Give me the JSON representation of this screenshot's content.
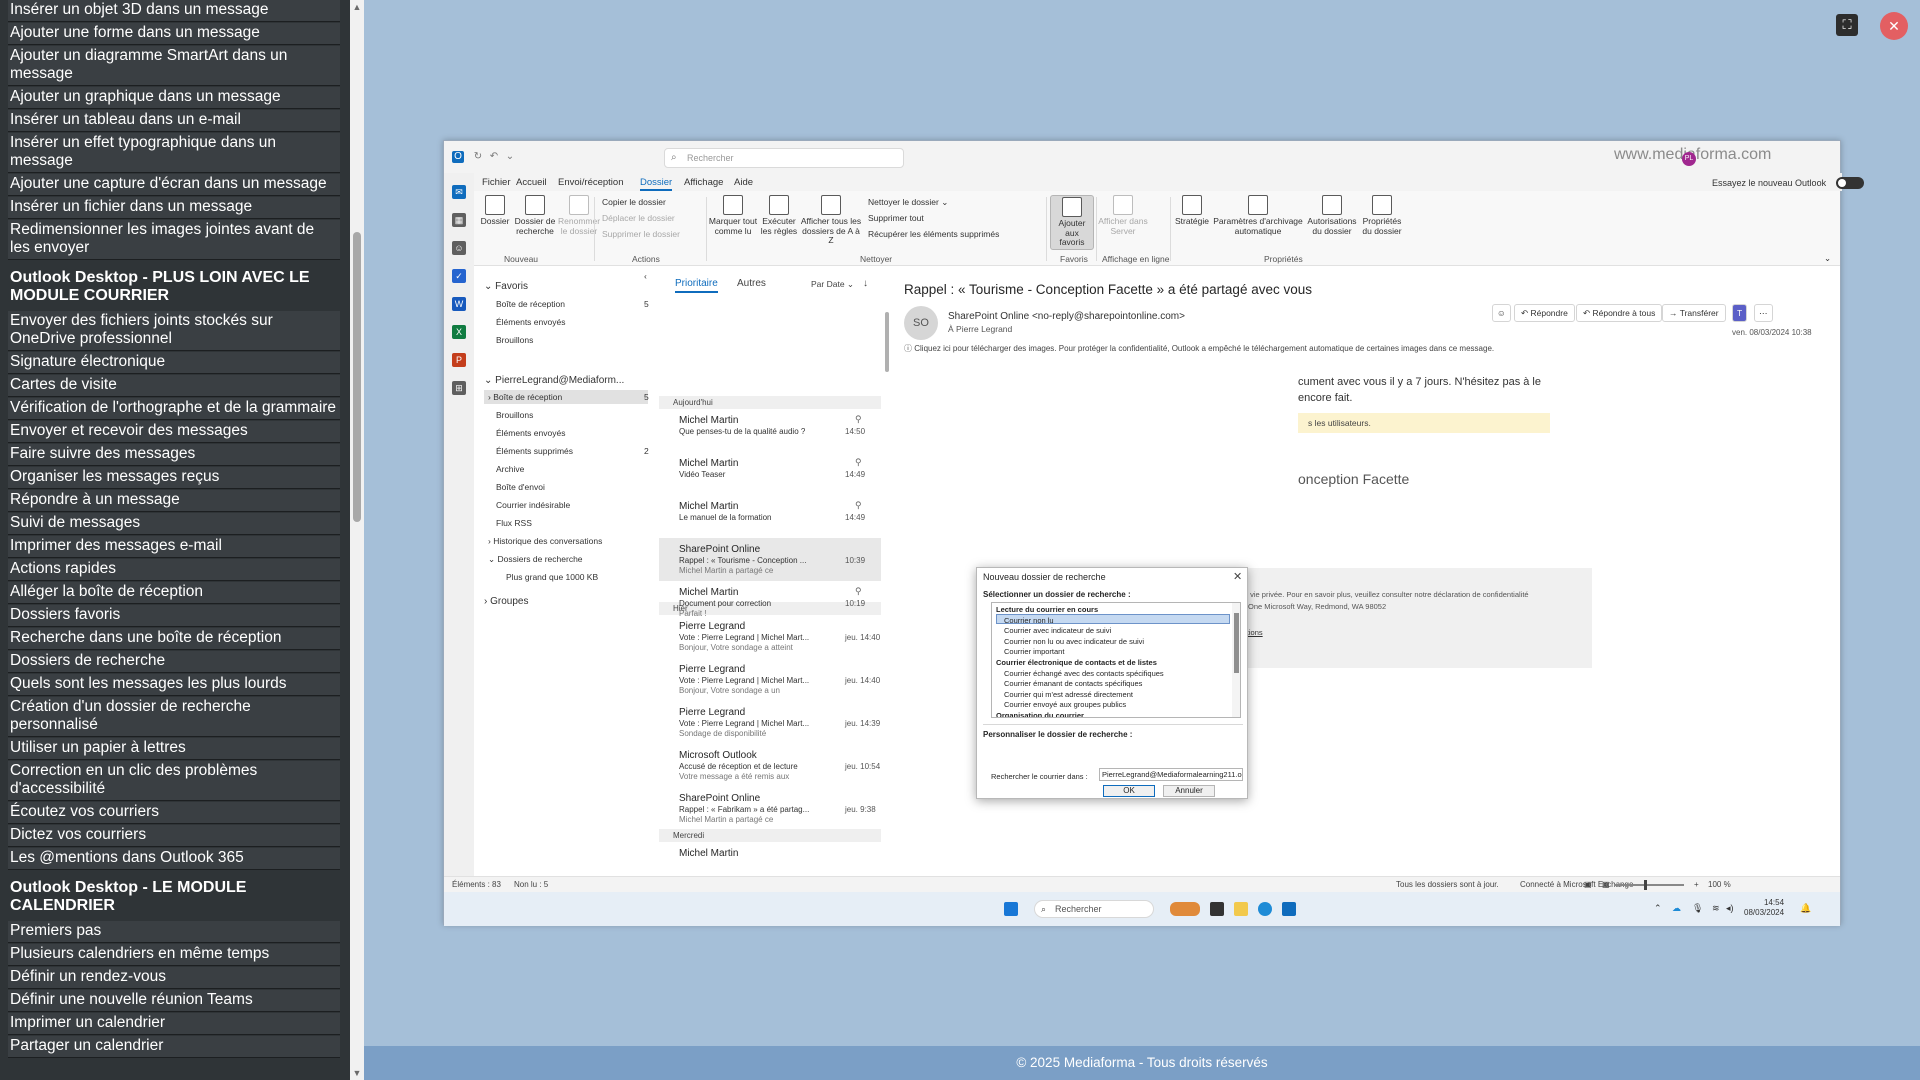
{
  "sidebar": {
    "items": [
      {
        "kind": "item",
        "label": "Insérer un objet 3D dans un message"
      },
      {
        "kind": "item",
        "label": "Ajouter une forme dans un message"
      },
      {
        "kind": "item",
        "label": "Ajouter un diagramme SmartArt dans un message"
      },
      {
        "kind": "item",
        "label": "Ajouter un graphique dans un message"
      },
      {
        "kind": "item",
        "label": "Insérer un tableau dans un e-mail"
      },
      {
        "kind": "item",
        "label": "Insérer un effet typographique dans un message"
      },
      {
        "kind": "item",
        "label": "Ajouter une capture d'écran dans un message"
      },
      {
        "kind": "item",
        "label": "Insérer un fichier dans un message"
      },
      {
        "kind": "item",
        "label": "Redimensionner les images jointes avant de les envoyer"
      },
      {
        "kind": "heading",
        "label": "Outlook Desktop - PLUS LOIN AVEC LE MODULE COURRIER"
      },
      {
        "kind": "item",
        "label": "Envoyer des fichiers joints stockés sur OneDrive professionnel"
      },
      {
        "kind": "item",
        "label": "Signature électronique"
      },
      {
        "kind": "item",
        "label": "Cartes de visite"
      },
      {
        "kind": "item",
        "label": "Vérification de l'orthographe et de la grammaire"
      },
      {
        "kind": "item",
        "label": "Envoyer et recevoir des messages"
      },
      {
        "kind": "item",
        "label": "Faire suivre des messages"
      },
      {
        "kind": "item",
        "label": "Organiser les messages reçus"
      },
      {
        "kind": "item",
        "label": "Répondre à un message"
      },
      {
        "kind": "item",
        "label": "Suivi de messages"
      },
      {
        "kind": "item",
        "label": "Imprimer des messages e-mail"
      },
      {
        "kind": "item",
        "label": "Actions rapides"
      },
      {
        "kind": "item",
        "label": "Alléger la boîte de réception"
      },
      {
        "kind": "item",
        "label": "Dossiers favoris"
      },
      {
        "kind": "item",
        "label": "Recherche dans une boîte de réception"
      },
      {
        "kind": "item",
        "label": "Dossiers de recherche"
      },
      {
        "kind": "item",
        "label": "Quels sont les messages les plus lourds"
      },
      {
        "kind": "item",
        "label": "Création d'un dossier de recherche personnalisé"
      },
      {
        "kind": "item",
        "label": "Utiliser un papier à lettres"
      },
      {
        "kind": "item",
        "label": "Correction en un clic des problèmes d'accessibilité"
      },
      {
        "kind": "item",
        "label": "Écoutez vos courriers"
      },
      {
        "kind": "item",
        "label": "Dictez vos courriers"
      },
      {
        "kind": "item",
        "label": "Les @mentions dans Outlook 365"
      },
      {
        "kind": "heading",
        "label": "Outlook Desktop - LE MODULE CALENDRIER"
      },
      {
        "kind": "item",
        "label": "Premiers pas"
      },
      {
        "kind": "item",
        "label": "Plusieurs calendriers en même temps"
      },
      {
        "kind": "item",
        "label": "Définir un rendez-vous"
      },
      {
        "kind": "item",
        "label": "Définir une nouvelle réunion Teams"
      },
      {
        "kind": "item",
        "label": "Imprimer un calendrier"
      },
      {
        "kind": "item",
        "label": "Partager un calendrier"
      }
    ]
  },
  "footer": "© 2025 Mediaforma - Tous droits réservés",
  "outlook": {
    "search_placeholder": "Rechercher",
    "watermark": "www.mediaforma.com",
    "avatar_initials": "PL",
    "menu": [
      "Fichier",
      "Accueil",
      "Envoi/réception",
      "Dossier",
      "Affichage",
      "Aide"
    ],
    "try_new_outlook": "Essayez le nouveau Outlook",
    "ribbon": {
      "dossier": "Dossier",
      "dossier_recherche": "Dossier de recherche",
      "renommer": "Renommer le dossier",
      "copier": "Copier le dossier",
      "deplacer": "Déplacer le dossier",
      "supprimer_dossier": "Supprimer le dossier",
      "marquer_lu": "Marquer tout comme lu",
      "executer_regles": "Exécuter les règles",
      "afficher_az": "Afficher tous les dossiers de A à Z",
      "nettoyer": "Nettoyer le dossier ⌄",
      "supprimer_tout": "Supprimer tout",
      "recuperer": "Récupérer les éléments supprimés",
      "favoris_btn": "Ajouter aux favoris",
      "afficher_serveur": "Afficher dans Server",
      "strategie": "Stratégie",
      "archivage": "Paramètres d'archivage automatique",
      "autorisations": "Autorisations du dossier",
      "proprietes": "Propriétés du dossier",
      "groups": [
        "Nouveau",
        "Actions",
        "Nettoyer",
        "Favoris",
        "Affichage en ligne",
        "Propriétés"
      ]
    },
    "folders": {
      "favoris": "Favoris",
      "fav_items": [
        {
          "label": "Boîte de réception",
          "count": "5"
        },
        {
          "label": "Éléments envoyés",
          "count": ""
        },
        {
          "label": "Brouillons",
          "count": ""
        }
      ],
      "account": "PierreLegrand@Mediaform...",
      "items": [
        {
          "label": "Boîte de réception",
          "count": "5"
        },
        {
          "label": "Brouillons",
          "count": ""
        },
        {
          "label": "Éléments envoyés",
          "count": ""
        },
        {
          "label": "Éléments supprimés",
          "count": "2"
        },
        {
          "label": "Archive",
          "count": ""
        },
        {
          "label": "Boîte d'envoi",
          "count": ""
        },
        {
          "label": "Courrier indésirable",
          "count": ""
        },
        {
          "label": "Flux RSS",
          "count": ""
        },
        {
          "label": "Historique des conversations",
          "count": ""
        },
        {
          "label": "Dossiers de recherche",
          "count": ""
        },
        {
          "label": "Plus grand que 1000 KB",
          "count": ""
        }
      ],
      "groupes": "Groupes"
    },
    "list": {
      "tab_prio": "Prioritaire",
      "tab_other": "Autres",
      "sort": "Par Date",
      "groups": [
        "Aujourd'hui",
        "Hier",
        "Mercredi"
      ],
      "messages": [
        {
          "from": "Michel Martin",
          "subject": "Que penses-tu de la qualité audio ?",
          "preview": "",
          "time": "14:50"
        },
        {
          "from": "Michel Martin",
          "subject": "Vidéo Teaser",
          "preview": "",
          "time": "14:49"
        },
        {
          "from": "Michel Martin",
          "subject": "Le manuel de la formation",
          "preview": "",
          "time": "14:49"
        },
        {
          "from": "SharePoint Online",
          "subject": "Rappel : « Tourisme - Conception ...",
          "preview": "Michel Martin a partagé ce",
          "time": "10:39"
        },
        {
          "from": "Michel Martin",
          "subject": "Document pour correction",
          "preview": "Parfait !",
          "time": "10:19"
        },
        {
          "from": "Pierre Legrand",
          "subject": "Vote : Pierre Legrand | Michel Mart...",
          "preview": "Bonjour, Votre sondage a atteint",
          "time": "jeu. 14:40"
        },
        {
          "from": "Pierre Legrand",
          "subject": "Vote : Pierre Legrand | Michel Mart...",
          "preview": "Bonjour, Votre sondage a un",
          "time": "jeu. 14:40"
        },
        {
          "from": "Pierre Legrand",
          "subject": "Vote : Pierre Legrand | Michel Mart...",
          "preview": "Sondage de disponibilité",
          "time": "jeu. 14:39"
        },
        {
          "from": "Microsoft Outlook",
          "subject": "Accusé de réception et de lecture",
          "preview": "Votre message a été remis aux",
          "time": "jeu. 10:54"
        },
        {
          "from": "SharePoint Online",
          "subject": "Rappel : « Fabrikam » a été partag...",
          "preview": "Michel Martin a partagé ce",
          "time": "jeu. 9:38"
        },
        {
          "from": "Michel Martin",
          "subject": "",
          "preview": "",
          "time": ""
        }
      ]
    },
    "reading": {
      "subject": "Rappel : « Tourisme - Conception Facette » a été partagé avec vous",
      "avatar": "SO",
      "from": "SharePoint Online <no-reply@sharepointonline.com>",
      "to": "À   Pierre Legrand",
      "buttons": [
        "Répondre",
        "Répondre à tous",
        "Transférer"
      ],
      "date": "ven. 08/03/2024 10:38",
      "info": "Cliquez ici pour télécharger des images. Pour protéger la confidentialité, Outlook a empêché le téléchargement automatique de certaines images dans ce message.",
      "body1": "cument avec vous il y a 7 jours. N'hésitez pas à le",
      "body2": "encore fait.",
      "yellow": "s les utilisateurs.",
      "title2": "onception Facette",
      "legal1": "Microsoft respecte votre vie privée. Pour en savoir plus, veuillez consulter notre déclaration de confidentialité",
      "legal2": ". Microsoft Corporation, One Microsoft Way, Redmond, WA 98052",
      "notif": "Paramètres des notifications"
    },
    "status": {
      "elements": "Éléments : 83",
      "non_lu": "Non lu : 5",
      "sync": "Tous les dossiers sont à jour.",
      "connected": "Connecté à Microsoft Exchange",
      "zoom": "100 %"
    },
    "taskbar": {
      "search": "Rechercher",
      "time": "14:54",
      "date": "08/03/2024"
    }
  },
  "dialog": {
    "title": "Nouveau dossier de recherche",
    "select_label": "Sélectionner un dossier de recherche :",
    "list": [
      {
        "kind": "cat",
        "label": "Lecture du courrier en cours"
      },
      {
        "kind": "it",
        "label": "Courrier non lu"
      },
      {
        "kind": "it",
        "label": "Courrier avec indicateur de suivi"
      },
      {
        "kind": "it",
        "label": "Courrier non lu ou avec indicateur de suivi"
      },
      {
        "kind": "it",
        "label": "Courrier important"
      },
      {
        "kind": "cat",
        "label": "Courrier électronique de contacts et de listes"
      },
      {
        "kind": "it",
        "label": "Courrier échangé avec des contacts spécifiques"
      },
      {
        "kind": "it",
        "label": "Courrier émanant de contacts spécifiques"
      },
      {
        "kind": "it",
        "label": "Courrier qui m'est adressé directement"
      },
      {
        "kind": "it",
        "label": "Courrier envoyé aux groupes publics"
      },
      {
        "kind": "cat",
        "label": "Organisation du courrier"
      }
    ],
    "personalize_label": "Personnaliser le dossier de recherche :",
    "search_in_label": "Rechercher le courrier dans :",
    "search_in_value": "PierreLegrand@Mediaformalearning211.onmicro ⌄",
    "ok": "OK",
    "cancel": "Annuler"
  },
  "colors": {
    "accent": "#0f6cbd",
    "panel_bg": "#2f3437",
    "content_bg": "#a5bfd8",
    "footer_bg": "#7b9fc6"
  }
}
